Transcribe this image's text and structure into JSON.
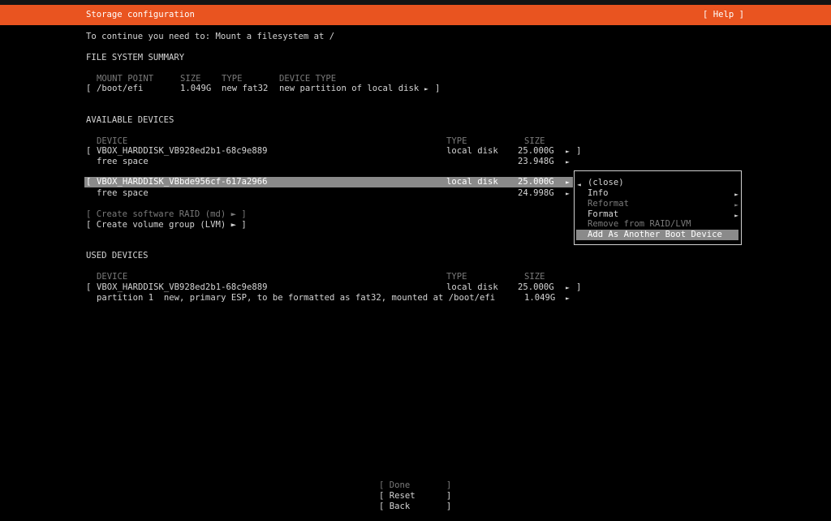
{
  "header": {
    "title": "Storage configuration",
    "help": "[ Help ]"
  },
  "instruction": "To continue you need to: Mount a filesystem at /",
  "fs_summary": {
    "heading": "FILE SYSTEM SUMMARY",
    "columns": [
      "MOUNT POINT",
      "SIZE",
      "TYPE",
      "DEVICE TYPE"
    ],
    "row": {
      "open": "[",
      "mount": "/boot/efi",
      "size": "1.049G",
      "type": "new fat32",
      "device_type": "new partition of local disk",
      "arrow": "►",
      "close": "]"
    }
  },
  "available": {
    "heading": "AVAILABLE DEVICES",
    "col_device": "DEVICE",
    "col_type": "TYPE",
    "col_size": "SIZE",
    "disk1": {
      "open": "[",
      "name": "VBOX_HARDDISK_VB928ed2b1-68c9e889",
      "type": "local disk",
      "size": "25.000G",
      "arrow": "►",
      "close": "]"
    },
    "disk1_free": {
      "label": "free space",
      "size": "23.948G",
      "arrow": "►"
    },
    "disk2": {
      "open": "[",
      "name": "VBOX_HARDDISK_VBbde956cf-617a2966",
      "type": "local disk",
      "size": "25.000G",
      "arrow": "►"
    },
    "disk2_free": {
      "label": "free space",
      "size": "24.998G",
      "arrow": "►"
    },
    "raid": "[ Create software RAID (md) ► ]",
    "lvm": "[ Create volume group (LVM) ► ]"
  },
  "used": {
    "heading": "USED DEVICES",
    "col_device": "DEVICE",
    "col_type": "TYPE",
    "col_size": "SIZE",
    "disk": {
      "open": "[",
      "name": "VBOX_HARDDISK_VB928ed2b1-68c9e889",
      "type": "local disk",
      "size": "25.000G",
      "arrow": "►",
      "close": "]"
    },
    "partition": {
      "label": "partition 1  new, primary ESP, to be formatted as fat32, mounted at /boot/efi",
      "size": "1.049G",
      "arrow": "►"
    }
  },
  "context_menu": {
    "close_arrow": "◄",
    "close": "(close)",
    "info": "Info",
    "reformat": "Reformat",
    "format": "Format",
    "remove": "Remove from RAID/LVM",
    "add_boot": "Add As Another Boot Device",
    "sub_arrow": "►"
  },
  "buttons": {
    "done": "[ Done       ]",
    "reset": "[ Reset      ]",
    "back": "[ Back       ]"
  }
}
